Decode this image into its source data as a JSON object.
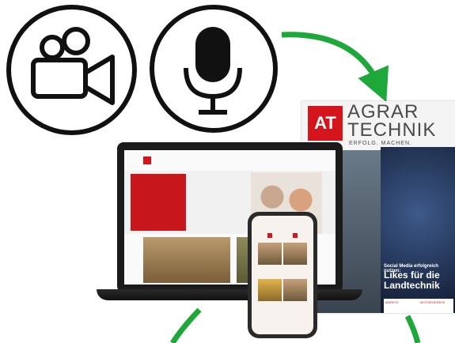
{
  "icons": {
    "video": "video-camera-icon",
    "mic": "microphone-icon"
  },
  "magazine": {
    "logo": "AT",
    "title_line1": "AGRAR",
    "title_line2": "TECHNIK",
    "subtitle": "ERFOLG. MACHEN.",
    "tagline": "Social Media erfolgreich nutzen:",
    "headline": "Likes für die Landtechnik",
    "footer_left": "MÄRKTE",
    "footer_right": "MOTORGERÄTE"
  },
  "colors": {
    "brand_red": "#d4151c",
    "arrow_green": "#1fa83a",
    "outline": "#111111"
  }
}
